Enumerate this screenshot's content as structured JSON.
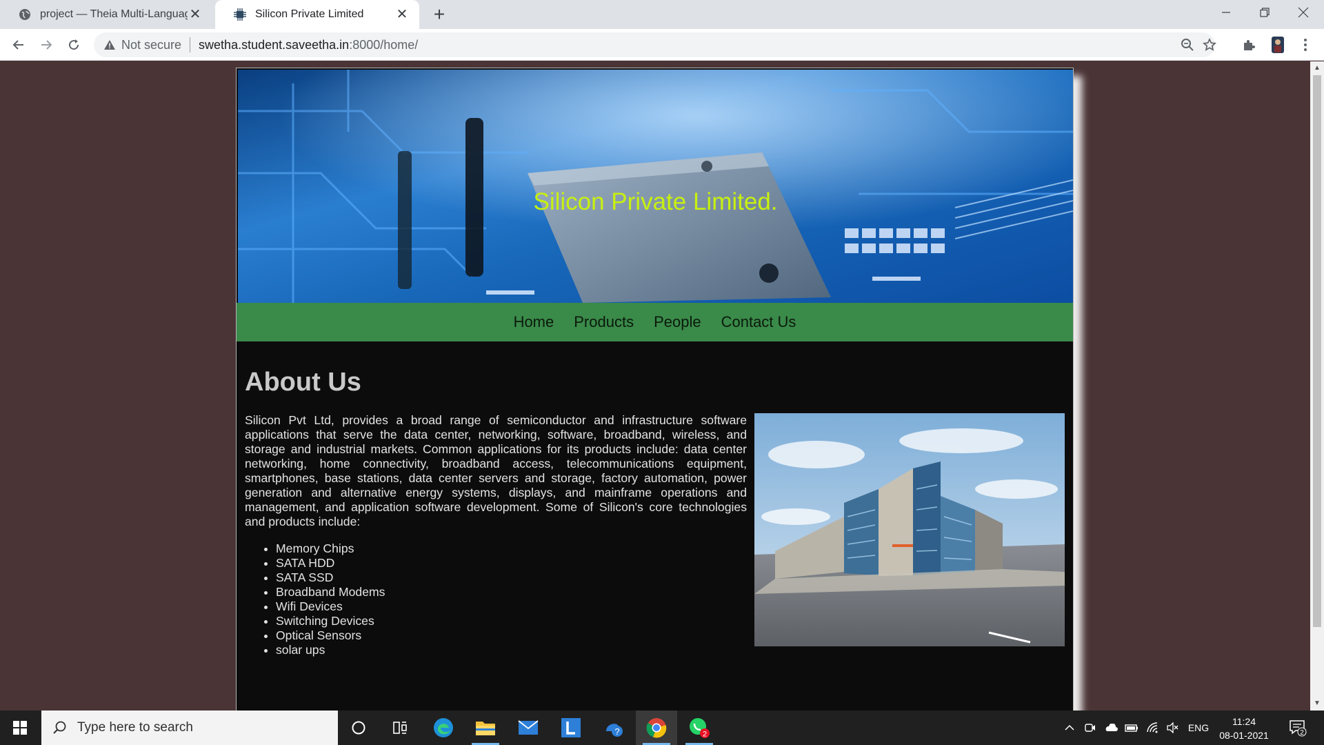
{
  "browser": {
    "tabs": [
      {
        "title": "project — Theia Multi-Language",
        "active": false
      },
      {
        "title": "Silicon Private Limited",
        "active": true
      }
    ],
    "security_label": "Not secure",
    "url_host": "swetha.student.saveetha.in",
    "url_path": ":8000/home/"
  },
  "site": {
    "banner_title": "Silicon Private Limited.",
    "nav": [
      "Home",
      "Products",
      "People",
      "Contact Us"
    ],
    "about_heading": "About Us",
    "about_text": "Silicon Pvt Ltd, provides a broad range of semiconductor and infrastructure software applications that serve the data center, networking, software, broadband, wireless, and storage and industrial markets. Common applications for its products include: data center networking, home connectivity, broadband access, telecommunications equipment, smartphones, base stations, data center servers and storage, factory automation, power generation and alternative energy systems, displays, and mainframe operations and management, and application software development. Some of Silicon's core technologies and products include:",
    "features": [
      "Memory Chips",
      "SATA HDD",
      "SATA SSD",
      "Broadband Modems",
      "Wifi Devices",
      "Switching Devices",
      "Optical Sensors",
      "solar ups"
    ]
  },
  "taskbar": {
    "search_placeholder": "Type here to search",
    "language": "ENG",
    "time": "11:24",
    "date": "08-01-2021",
    "whatsapp_badge": "2",
    "notification_count": "2"
  },
  "colors": {
    "page_background": "#4a3436",
    "nav_background": "#3a8a4a",
    "banner_title": "#c8f010",
    "content_background": "#0c0c0c"
  }
}
